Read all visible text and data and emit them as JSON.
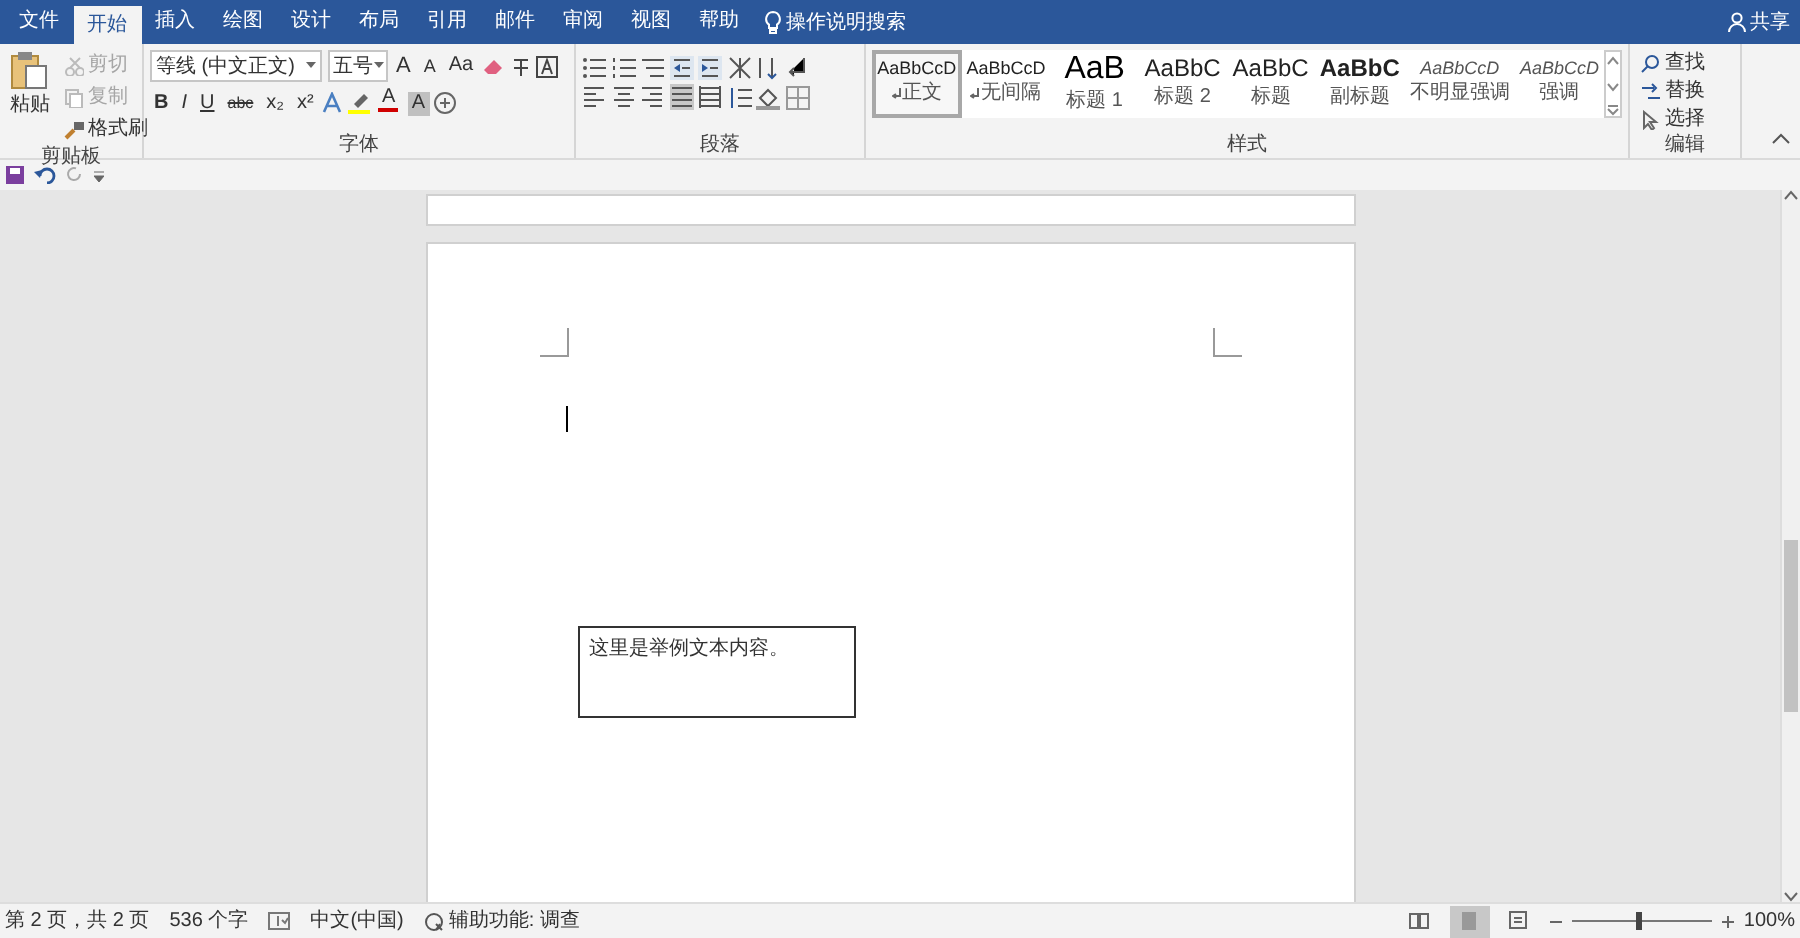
{
  "tabs": [
    {
      "label": "文件",
      "selected": false
    },
    {
      "label": "开始",
      "selected": true
    },
    {
      "label": "插入",
      "selected": false
    },
    {
      "label": "绘图",
      "selected": false
    },
    {
      "label": "设计",
      "selected": false
    },
    {
      "label": "布局",
      "selected": false
    },
    {
      "label": "引用",
      "selected": false
    },
    {
      "label": "邮件",
      "selected": false
    },
    {
      "label": "审阅",
      "selected": false
    },
    {
      "label": "视图",
      "selected": false
    },
    {
      "label": "帮助",
      "selected": false
    }
  ],
  "tell_me": "操作说明搜索",
  "share": "共享",
  "clipboard": {
    "label": "剪贴板",
    "paste": "粘贴",
    "items": [
      {
        "kind": "cut",
        "label": "剪切",
        "disabled": true
      },
      {
        "kind": "copy",
        "label": "复制",
        "disabled": true
      },
      {
        "kind": "painter",
        "label": "格式刷",
        "disabled": false
      }
    ]
  },
  "font": {
    "label": "字体",
    "font_name": "等线 (中文正文)",
    "font_size": "五号",
    "row1": [
      "A",
      "A",
      "Aa"
    ],
    "row2": [
      "B",
      "I",
      "U",
      "abc",
      "x₂",
      "x²"
    ],
    "color_letter": "A",
    "shade_letter": "A"
  },
  "paragraph": {
    "label": "段落",
    "align_buttons": [
      {
        "selected": false
      },
      {
        "selected": false
      },
      {
        "selected": false
      },
      {
        "selected": true
      },
      {
        "selected": false
      }
    ]
  },
  "styles": {
    "label": "样式",
    "items": [
      {
        "preview": "AaBbCcD",
        "name": "正文",
        "kind": "normal",
        "mark": true,
        "selected": true
      },
      {
        "preview": "AaBbCcD",
        "name": "无间隔",
        "kind": "normal",
        "mark": true,
        "selected": false
      },
      {
        "preview": "AaB",
        "name": "标题 1",
        "kind": "h1",
        "mark": false,
        "selected": false
      },
      {
        "preview": "AaBbC",
        "name": "标题 2",
        "kind": "h2",
        "mark": false,
        "selected": false
      },
      {
        "preview": "AaBbC",
        "name": "标题",
        "kind": "h2",
        "mark": false,
        "selected": false
      },
      {
        "preview": "AaBbC",
        "name": "副标题",
        "kind": "bold",
        "mark": false,
        "selected": false
      },
      {
        "preview": "AaBbCcD",
        "name": "不明显强调",
        "kind": "italic",
        "mark": false,
        "selected": false
      },
      {
        "preview": "AaBbCcD",
        "name": "强调",
        "kind": "italic",
        "mark": false,
        "selected": false
      }
    ]
  },
  "editing": {
    "label": "编辑",
    "items": [
      {
        "kind": "find",
        "label": "查找"
      },
      {
        "kind": "replace",
        "label": "替换"
      },
      {
        "kind": "select",
        "label": "选择"
      }
    ]
  },
  "document": {
    "text_box": "这里是举例文本内容。"
  },
  "status_bar": {
    "page": "第 2 页，共 2 页",
    "words": "536 个字",
    "language": "中文(中国)",
    "accessibility": "辅助功能: 调查",
    "views": [
      {
        "selected": false
      },
      {
        "selected": true
      },
      {
        "selected": false
      }
    ],
    "zoom": {
      "level": 0.47
    },
    "zoom_text": "100%"
  }
}
